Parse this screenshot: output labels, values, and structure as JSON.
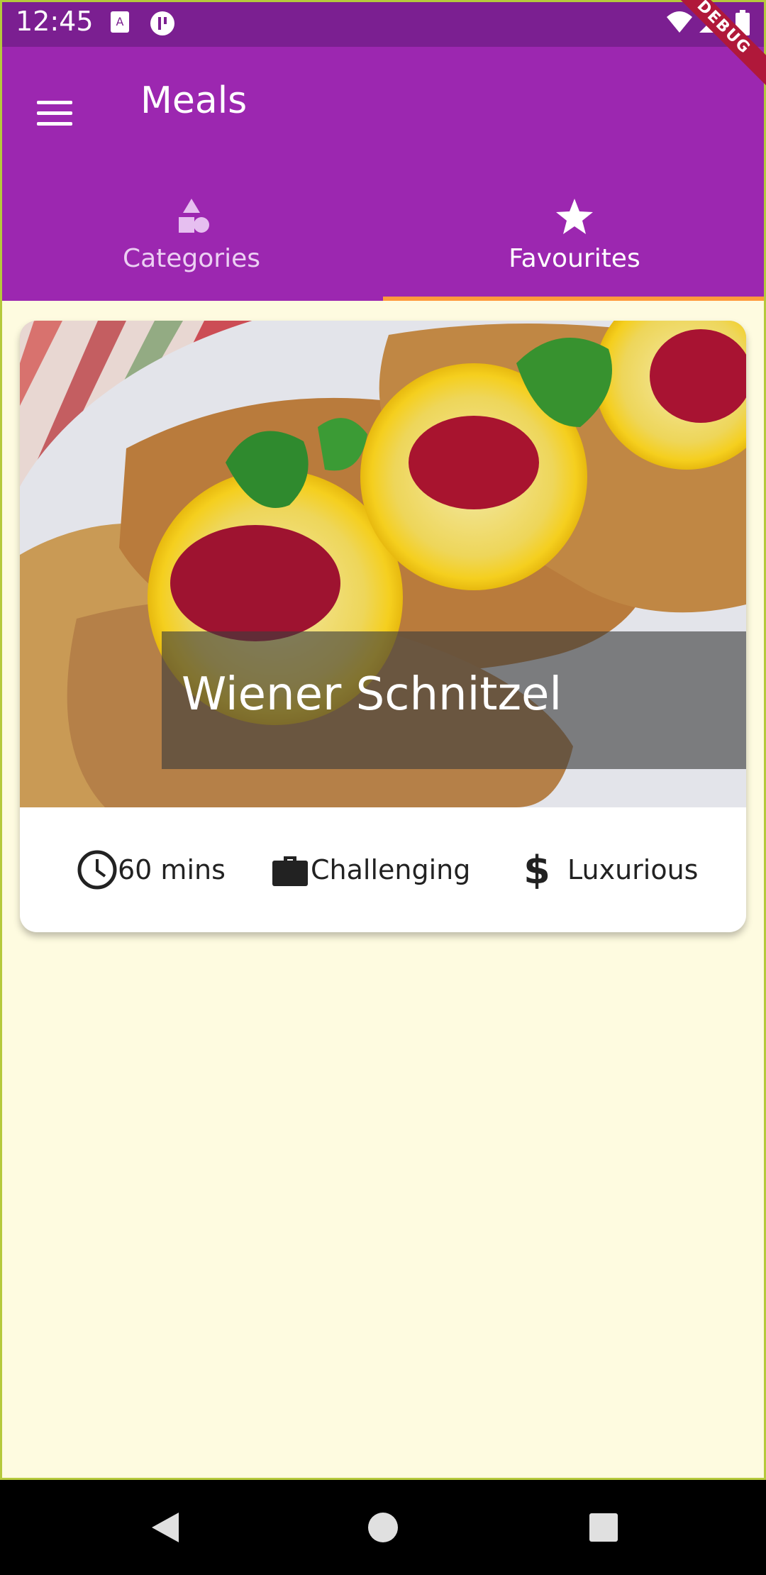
{
  "status_bar": {
    "time": "12:45"
  },
  "app_bar": {
    "title": "Meals",
    "debug_banner": "DEBUG"
  },
  "tabs": [
    {
      "label": "Categories",
      "icon": "category-icon",
      "selected": false
    },
    {
      "label": "Favourites",
      "icon": "star-icon",
      "selected": true
    }
  ],
  "meal": {
    "title": "Wiener Schnitzel",
    "duration": "60 mins",
    "complexity": "Challenging",
    "affordability": "Luxurious"
  },
  "colors": {
    "primary": "#9c27b0",
    "status_bar": "#7b1f91",
    "accent": "#ff9a3c",
    "background": "#fefbe0"
  }
}
